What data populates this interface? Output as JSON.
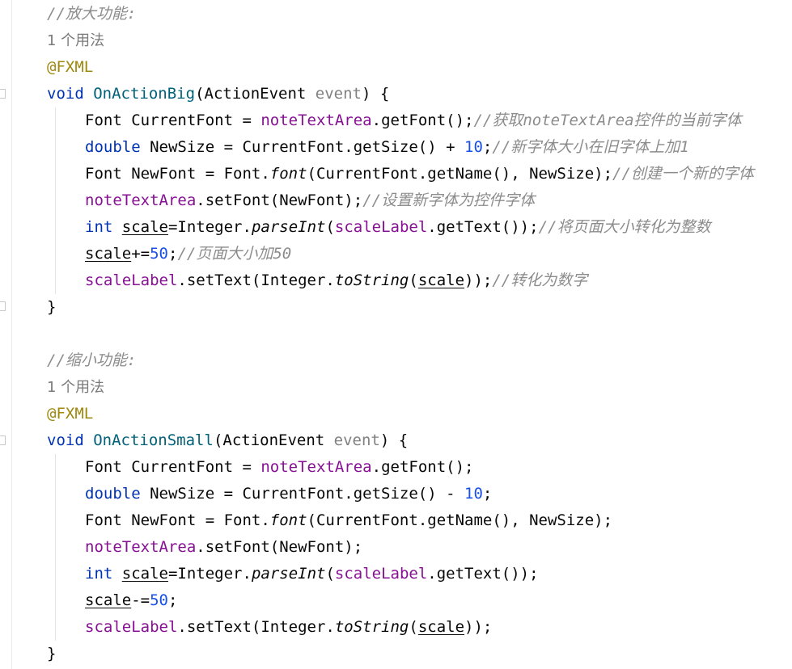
{
  "colors": {
    "comment": "#8c8c8c",
    "keyword": "#0033b3",
    "annotation": "#9e880d",
    "method_decl": "#00627a",
    "field": "#871094",
    "parameter": "#808080",
    "number": "#1750eb",
    "text": "#080808"
  },
  "block1": {
    "comment": "//放大功能:",
    "usage": "1 个用法",
    "annotation": "@FXML",
    "kw_void": "void",
    "method": "OnActionBig",
    "param_open": "(ActionEvent ",
    "param_name": "event",
    "param_close": ") {",
    "l1": {
      "a": "Font CurrentFont = ",
      "f": "noteTextArea",
      "b": ".getFont();",
      "c": "//获取noteTextArea控件的当前字体"
    },
    "l2": {
      "kw": "double",
      "a": " NewSize = CurrentFont.getSize() + ",
      "n": "10",
      "b": ";",
      "c": "//新字体大小在旧字体上加1"
    },
    "l3": {
      "a": "Font NewFont = Font.",
      "i": "font",
      "b": "(CurrentFont.getName(), NewSize);",
      "c": "//创建一个新的字体"
    },
    "l4": {
      "f": "noteTextArea",
      "b": ".setFont(NewFont);",
      "c": "//设置新字体为控件字体"
    },
    "l5": {
      "kw": "int",
      "sp": " ",
      "u": "scale",
      "a": "=Integer.",
      "i": "parseInt",
      "p": "(",
      "f": "scaleLabel",
      "b": ".getText());",
      "c": "//将页面大小转化为整数"
    },
    "l6": {
      "u": "scale",
      "a": "+=",
      "n": "50",
      "b": ";",
      "c": "//页面大小加50"
    },
    "l7": {
      "f": "scaleLabel",
      "a": ".setText(Integer.",
      "i": "toString",
      "p": "(",
      "u": "scale",
      "b": "));",
      "c": "//转化为数字"
    },
    "close": "}"
  },
  "block2": {
    "comment": "//缩小功能:",
    "usage": "1 个用法",
    "annotation": "@FXML",
    "kw_void": "void",
    "method": "OnActionSmall",
    "param_open": "(ActionEvent ",
    "param_name": "event",
    "param_close": ") {",
    "l1": {
      "a": "Font CurrentFont = ",
      "f": "noteTextArea",
      "b": ".getFont();"
    },
    "l2": {
      "kw": "double",
      "a": " NewSize = CurrentFont.getSize() - ",
      "n": "10",
      "b": ";"
    },
    "l3": {
      "a": "Font NewFont = Font.",
      "i": "font",
      "b": "(CurrentFont.getName(), NewSize);"
    },
    "l4": {
      "f": "noteTextArea",
      "b": ".setFont(NewFont);"
    },
    "l5": {
      "kw": "int",
      "sp": " ",
      "u": "scale",
      "a": "=Integer.",
      "i": "parseInt",
      "p": "(",
      "f": "scaleLabel",
      "b": ".getText());"
    },
    "l6": {
      "u": "scale",
      "a": "-=",
      "n": "50",
      "b": ";"
    },
    "l7": {
      "f": "scaleLabel",
      "a": ".setText(Integer.",
      "i": "toString",
      "p": "(",
      "u": "scale",
      "b": "));"
    },
    "close": "}"
  }
}
